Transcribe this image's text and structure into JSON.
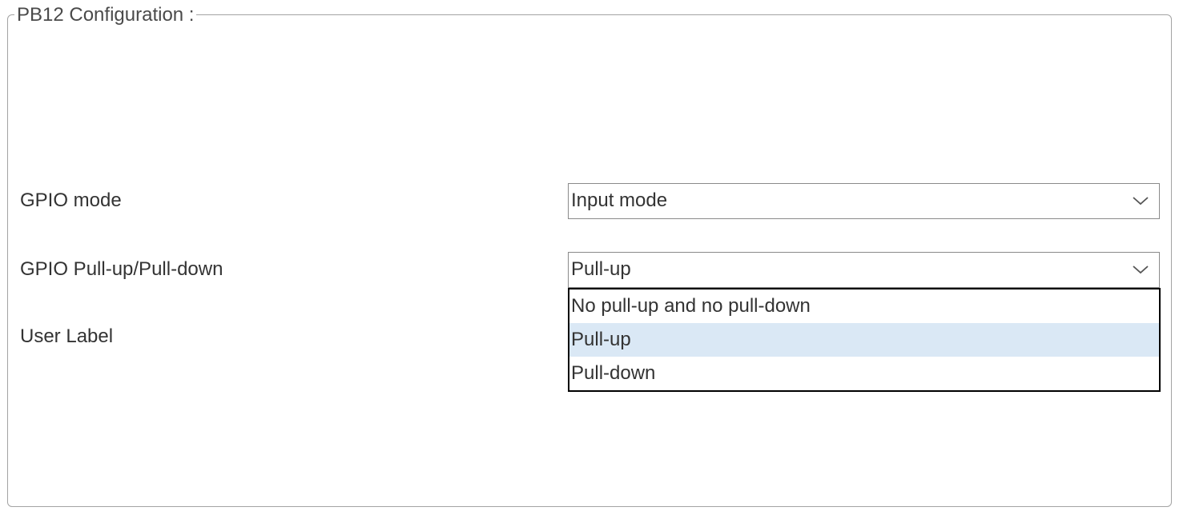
{
  "panel": {
    "title": "PB12 Configuration :"
  },
  "fields": {
    "gpio_mode": {
      "label": "GPIO mode",
      "value": "Input mode"
    },
    "gpio_pull": {
      "label": "GPIO Pull-up/Pull-down",
      "value": "Pull-up",
      "options": [
        "No pull-up and no pull-down",
        "Pull-up",
        "Pull-down"
      ],
      "highlighted_option": "Pull-up"
    },
    "user_label": {
      "label": "User Label"
    }
  },
  "colors": {
    "highlight": "#dae8f5",
    "border": "#8a8a8a",
    "text": "#333333"
  },
  "icons": {
    "dropdown_arrow": "chevron-down-icon"
  }
}
